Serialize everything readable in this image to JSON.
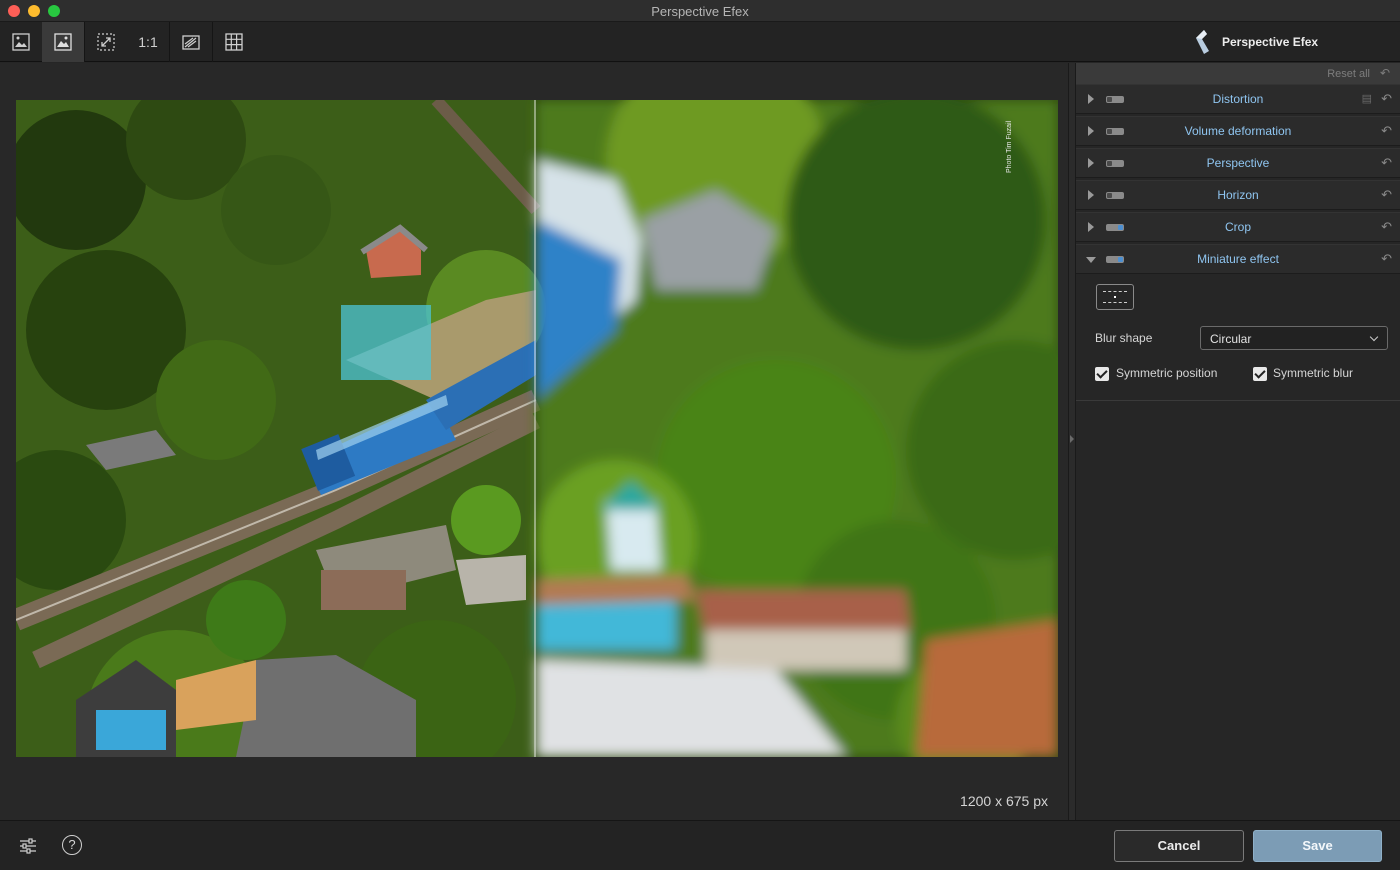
{
  "window": {
    "title": "Perspective Efex"
  },
  "toolbar": {
    "tools": [
      {
        "name": "before-after-icon"
      },
      {
        "name": "image-view-icon",
        "active": true
      },
      {
        "name": "fit-screen-icon"
      },
      {
        "label": "1:1"
      },
      {
        "name": "split-view-icon"
      },
      {
        "name": "grid-icon"
      }
    ],
    "brand": "Perspective Efex"
  },
  "canvas": {
    "image_size": "1200 x 675 px",
    "watermark": "Photo Tim Fuzail"
  },
  "panel": {
    "reset_all": "Reset all",
    "sections": [
      {
        "title": "Distortion",
        "expanded": false,
        "enabled": false
      },
      {
        "title": "Volume deformation",
        "expanded": false,
        "enabled": false
      },
      {
        "title": "Perspective",
        "expanded": false,
        "enabled": false
      },
      {
        "title": "Horizon",
        "expanded": false,
        "enabled": false
      },
      {
        "title": "Crop",
        "expanded": false,
        "enabled": true
      },
      {
        "title": "Miniature effect",
        "expanded": true,
        "enabled": true
      }
    ],
    "miniature": {
      "blur_shape_label": "Blur shape",
      "blur_shape_value": "Circular",
      "symmetric_position": {
        "label": "Symmetric position",
        "checked": true
      },
      "symmetric_blur": {
        "label": "Symmetric blur",
        "checked": true
      }
    }
  },
  "bottom": {
    "help": "?",
    "cancel": "Cancel",
    "save": "Save"
  },
  "colors": {
    "accent_text": "#8fc5f0",
    "save_button": "#7c9cb5"
  }
}
